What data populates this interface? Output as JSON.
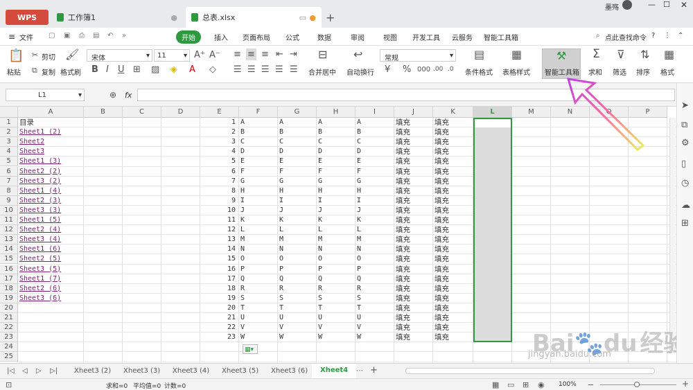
{
  "window": {
    "logo": "WPS",
    "tabs": [
      {
        "label": "工作簿1"
      },
      {
        "label": "总表.xlsx"
      }
    ],
    "user": "墨殇"
  },
  "menu": {
    "file": "文件",
    "items": [
      "开始",
      "插入",
      "页面布局",
      "公式",
      "数据",
      "审阅",
      "视图",
      "开发工具",
      "云服务",
      "智能工具箱"
    ],
    "search": "点此查找命令"
  },
  "ribbon": {
    "paste": "粘贴",
    "cut": "剪切",
    "copy": "复制",
    "format_painter": "格式刷",
    "font_name": "宋体",
    "font_size": "11",
    "merge_center": "合并居中",
    "wrap_text": "自动换行",
    "number_format": "常规",
    "cond_format": "条件格式",
    "table_style": "表格样式",
    "smart_toolbox": "智能工具箱",
    "sum": "求和",
    "filter": "筛选",
    "sort": "排序",
    "format": "格式"
  },
  "formula_bar": {
    "name_box": "L1",
    "fx": "fx",
    "value": ""
  },
  "columns": [
    "A",
    "B",
    "C",
    "D",
    "E",
    "F",
    "G",
    "H",
    "I",
    "J",
    "K",
    "L",
    "M",
    "N",
    "O",
    "P"
  ],
  "rows": [
    "1",
    "2",
    "3",
    "4",
    "5",
    "6",
    "7",
    "8",
    "9",
    "10",
    "11",
    "12",
    "13",
    "14",
    "15",
    "16",
    "17",
    "18",
    "19",
    "20",
    "21",
    "22",
    "23",
    "24",
    "25"
  ],
  "colA": [
    "目录",
    "Sheet1 (2)",
    "Sheet2",
    "Sheet3",
    "Sheet1 (3)",
    "Sheet2 (2)",
    "Sheet3 (2)",
    "Sheet1 (4)",
    "Sheet2 (3)",
    "Sheet3 (3)",
    "Sheet1 (5)",
    "Sheet2 (4)",
    "Sheet3 (4)",
    "Sheet1 (6)",
    "Sheet2 (5)",
    "Sheet3 (5)",
    "Sheet1 (7)",
    "Sheet2 (6)",
    "Sheet3 (6)"
  ],
  "colE": [
    "1",
    "2",
    "3",
    "4",
    "5",
    "6",
    "7",
    "8",
    "9",
    "10",
    "11",
    "12",
    "13",
    "14",
    "15",
    "16",
    "17",
    "18",
    "19",
    "20",
    "21",
    "22",
    "23"
  ],
  "colF": [
    "A",
    "B",
    "C",
    "D",
    "E",
    "F",
    "G",
    "H",
    "I",
    "J",
    "K",
    "L",
    "M",
    "N",
    "O",
    "P",
    "Q",
    "R",
    "S",
    "T",
    "U",
    "V",
    "W"
  ],
  "colJ": "填充",
  "sheets": [
    "Xheet3 (2)",
    "Xheet3 (3)",
    "Xheet3 (4)",
    "Xheet3 (5)",
    "Xheet3 (6)",
    "Xheet4"
  ],
  "status": {
    "sum": "求和=0",
    "avg": "平均值=0",
    "count": "计数=0",
    "zoom": "100%"
  },
  "watermark": {
    "brand": "Bai",
    "brand2": "du",
    "text": "经验",
    "url": "jingyan.baidu.com"
  },
  "colors": {
    "accent": "#2e9a3f",
    "selection": "#dcdcdc",
    "link": "#7a1f72"
  }
}
